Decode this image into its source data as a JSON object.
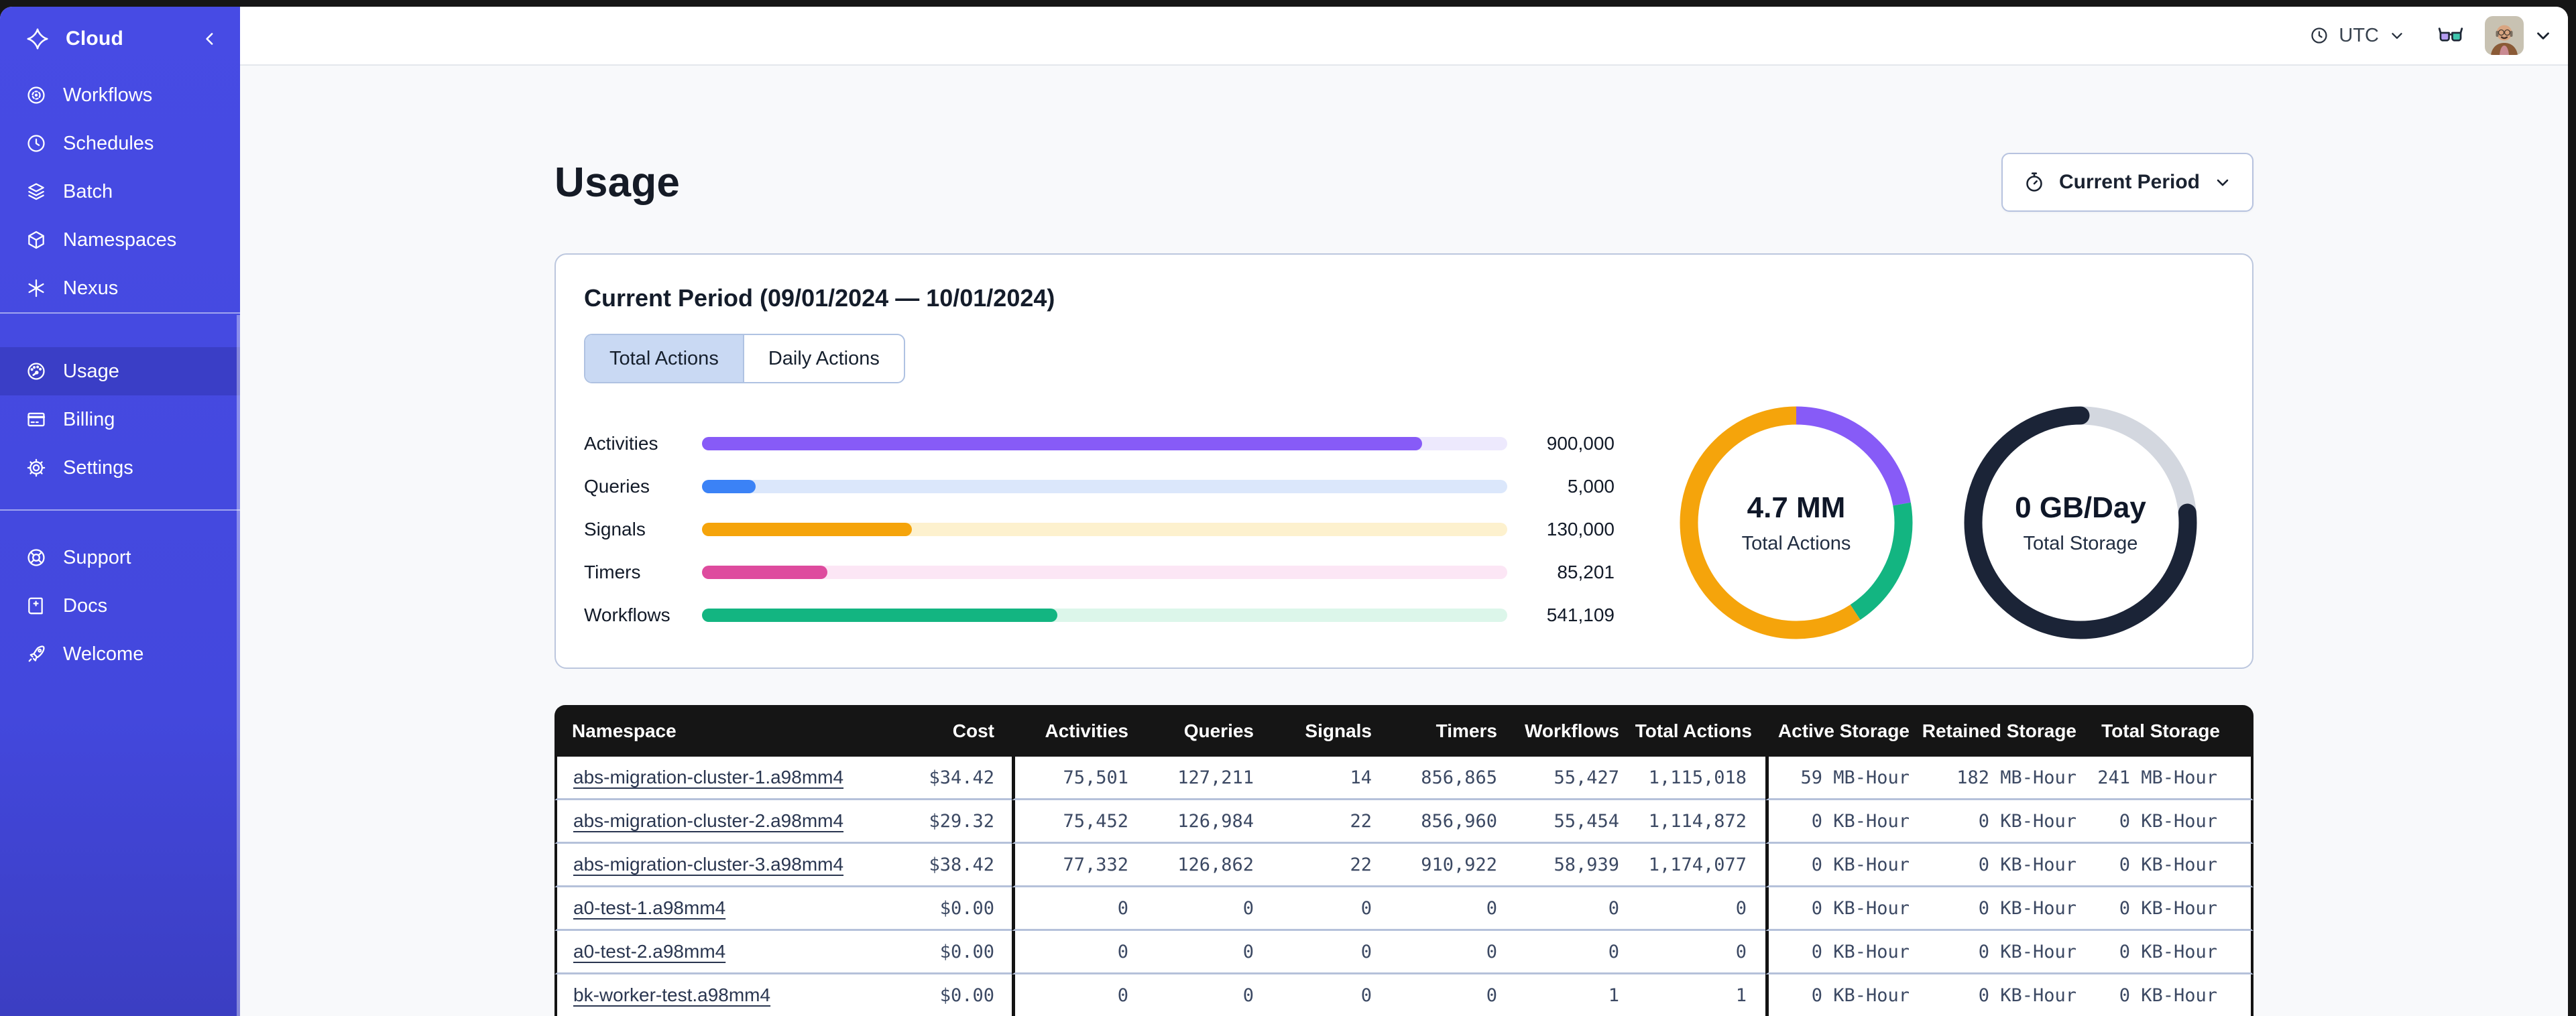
{
  "sidebar": {
    "brand": "Cloud",
    "nav": [
      {
        "label": "Workflows"
      },
      {
        "label": "Schedules"
      },
      {
        "label": "Batch"
      },
      {
        "label": "Namespaces"
      },
      {
        "label": "Nexus"
      }
    ],
    "account": [
      {
        "label": "Usage",
        "active": true
      },
      {
        "label": "Billing"
      },
      {
        "label": "Settings"
      }
    ],
    "footer": [
      {
        "label": "Support"
      },
      {
        "label": "Docs"
      },
      {
        "label": "Welcome"
      }
    ]
  },
  "topbar": {
    "timezone": "UTC"
  },
  "page": {
    "title": "Usage",
    "period_selector": "Current Period"
  },
  "panel": {
    "title": "Current Period (09/01/2024 — 10/01/2024)",
    "tabs": [
      {
        "label": "Total Actions",
        "selected": true
      },
      {
        "label": "Daily Actions",
        "selected": false
      }
    ]
  },
  "colors": {
    "sidebar_indigo": "#444CE7",
    "sidebar_active": "#3A3EC6",
    "activities_purple": "#875BF7",
    "queries_blue": "#3B82F6",
    "signals_orange": "#F5A40B",
    "timers_pink": "#DE4B9E",
    "workflows_green": "#13B581",
    "storage_navy": "#1B2437",
    "storage_gray": "#D3D7DF",
    "tab_selected_bg": "#C9D9F3",
    "table_header_bg": "#151515"
  },
  "chart_data": [
    {
      "type": "bar",
      "orientation": "horizontal",
      "categories": [
        "Activities",
        "Queries",
        "Signals",
        "Timers",
        "Workflows"
      ],
      "values": [
        900000,
        5000,
        130000,
        85201,
        541109
      ],
      "value_labels": [
        "900,000",
        "5,000",
        "130,000",
        "85,201",
        "541,109"
      ],
      "fill_fractions": [
        0.894,
        0.067,
        0.261,
        0.156,
        0.441
      ],
      "colors": [
        "#875BF7",
        "#3B82F6",
        "#F5A40B",
        "#DE4B9E",
        "#13B581"
      ],
      "track_colors": [
        "#EDE9FD",
        "#DBE7FB",
        "#FDF1CE",
        "#FCE6F5",
        "#DCF6EA"
      ],
      "title": "",
      "xlabel": "",
      "ylabel": ""
    },
    {
      "type": "donut",
      "center_value": "4.7 MM",
      "center_label": "Total Actions",
      "segments": [
        {
          "name": "segment-purple",
          "color": "#875BF7",
          "fraction": 0.222
        },
        {
          "name": "segment-green",
          "color": "#13B581",
          "fraction": 0.185
        },
        {
          "name": "segment-orange",
          "color": "#F5A40B",
          "fraction": 0.593
        }
      ]
    },
    {
      "type": "donut",
      "center_value": "0 GB/Day",
      "center_label": "Total Storage",
      "segments": [
        {
          "name": "segment-gray",
          "color": "#D3D7DF",
          "fraction": 0.235
        },
        {
          "name": "segment-navy",
          "color": "#1B2437",
          "fraction": 0.765,
          "cap": "round"
        }
      ]
    }
  ],
  "table": {
    "columns": [
      "Namespace",
      "Cost",
      "Activities",
      "Queries",
      "Signals",
      "Timers",
      "Workflows",
      "Total Actions",
      "Active Storage",
      "Retained Storage",
      "Total Storage"
    ],
    "rows": [
      [
        "abs-migration-cluster-1.a98mm4",
        "$34.42",
        "75,501",
        "127,211",
        "14",
        "856,865",
        "55,427",
        "1,115,018",
        "59 MB-Hour",
        "182 MB-Hour",
        "241 MB-Hour"
      ],
      [
        "abs-migration-cluster-2.a98mm4",
        "$29.32",
        "75,452",
        "126,984",
        "22",
        "856,960",
        "55,454",
        "1,114,872",
        "0 KB-Hour",
        "0 KB-Hour",
        "0 KB-Hour"
      ],
      [
        "abs-migration-cluster-3.a98mm4",
        "$38.42",
        "77,332",
        "126,862",
        "22",
        "910,922",
        "58,939",
        "1,174,077",
        "0 KB-Hour",
        "0 KB-Hour",
        "0 KB-Hour"
      ],
      [
        "a0-test-1.a98mm4",
        "$0.00",
        "0",
        "0",
        "0",
        "0",
        "0",
        "0",
        "0 KB-Hour",
        "0 KB-Hour",
        "0 KB-Hour"
      ],
      [
        "a0-test-2.a98mm4",
        "$0.00",
        "0",
        "0",
        "0",
        "0",
        "0",
        "0",
        "0 KB-Hour",
        "0 KB-Hour",
        "0 KB-Hour"
      ],
      [
        "bk-worker-test.a98mm4",
        "$0.00",
        "0",
        "0",
        "0",
        "0",
        "1",
        "1",
        "0 KB-Hour",
        "0 KB-Hour",
        "0 KB-Hour"
      ]
    ]
  }
}
